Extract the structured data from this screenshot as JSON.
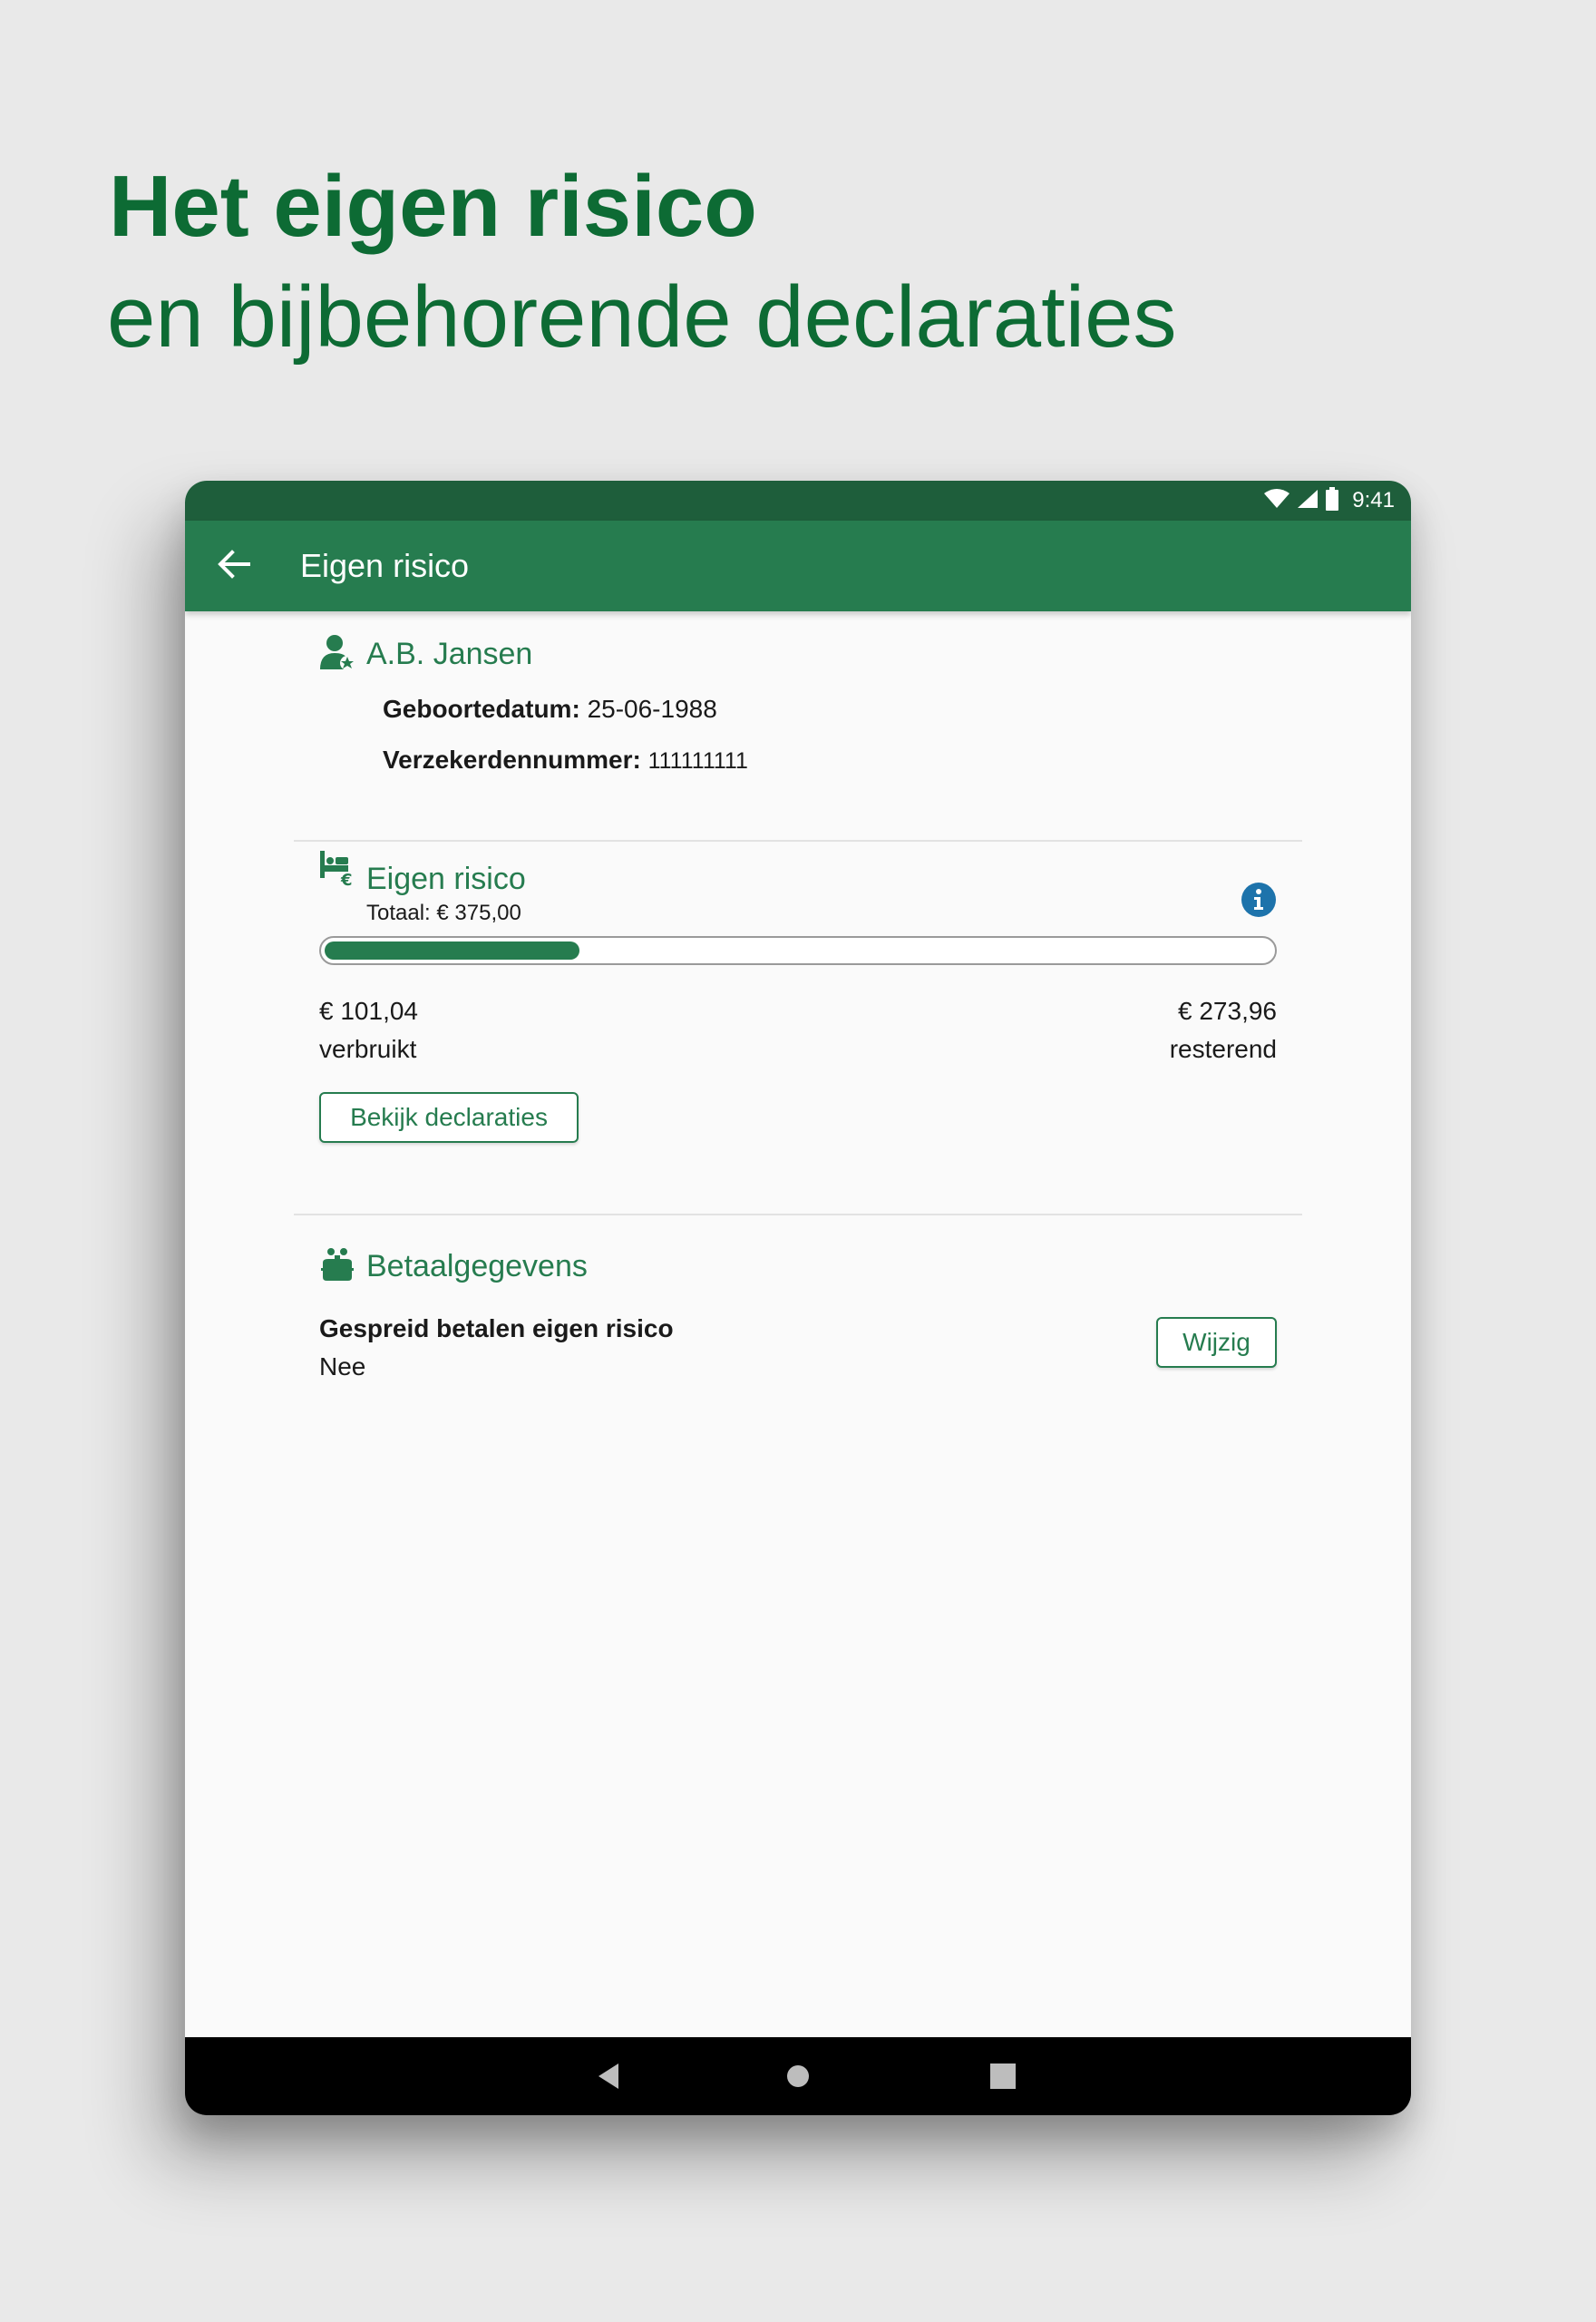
{
  "promo": {
    "title": "Het eigen risico",
    "subtitle": "en bijbehorende declaraties"
  },
  "status_bar": {
    "time": "9:41",
    "icons": [
      "wifi-icon",
      "signal-icon",
      "battery-icon"
    ]
  },
  "app_bar": {
    "title": "Eigen risico",
    "back_icon": "arrow-left-icon"
  },
  "person": {
    "icon": "person-star-icon",
    "name": "A.B. Jansen",
    "birth_label": "Geboortedatum:",
    "birth_value": "25-06-1988",
    "policy_label": "Verzekerdennummer:",
    "policy_value": "111111111"
  },
  "deductible": {
    "icon": "bed-euro-icon",
    "title": "Eigen risico",
    "total": "Totaal: € 375,00",
    "info_icon": "info-icon",
    "progress_used_fraction": 0.2694,
    "used_amount": "€ 101,04",
    "used_label": "verbruikt",
    "remaining_amount": "€ 273,96",
    "remaining_label": "resterend",
    "button": "Bekijk declaraties"
  },
  "payment": {
    "icon": "piggy-bank-icon",
    "title": "Betaalgegevens",
    "label": "Gespreid betalen eigen risico",
    "value": "Nee",
    "button": "Wijzig"
  },
  "nav_bar": {
    "icons": [
      "back-triangle-icon",
      "home-circle-icon",
      "recents-square-icon"
    ]
  },
  "colors": {
    "brand_green": "#267c4f",
    "dark_green": "#1e5e3b",
    "promo_green": "#0d6b34",
    "background": "#e9e9e9"
  }
}
